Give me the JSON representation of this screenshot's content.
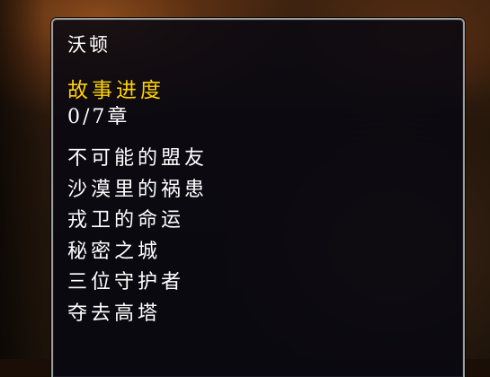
{
  "tooltip": {
    "title": "沃顿",
    "section_header": "故事进度",
    "progress": "0/7章",
    "chapters": [
      "不可能的盟友",
      "沙漠里的祸患",
      "戎卫的命运",
      "秘密之城",
      "三位守护者",
      "夺去高塔"
    ]
  },
  "colors": {
    "header": "#ffd200",
    "text": "#ffffff",
    "border": "#9c9c9c"
  }
}
